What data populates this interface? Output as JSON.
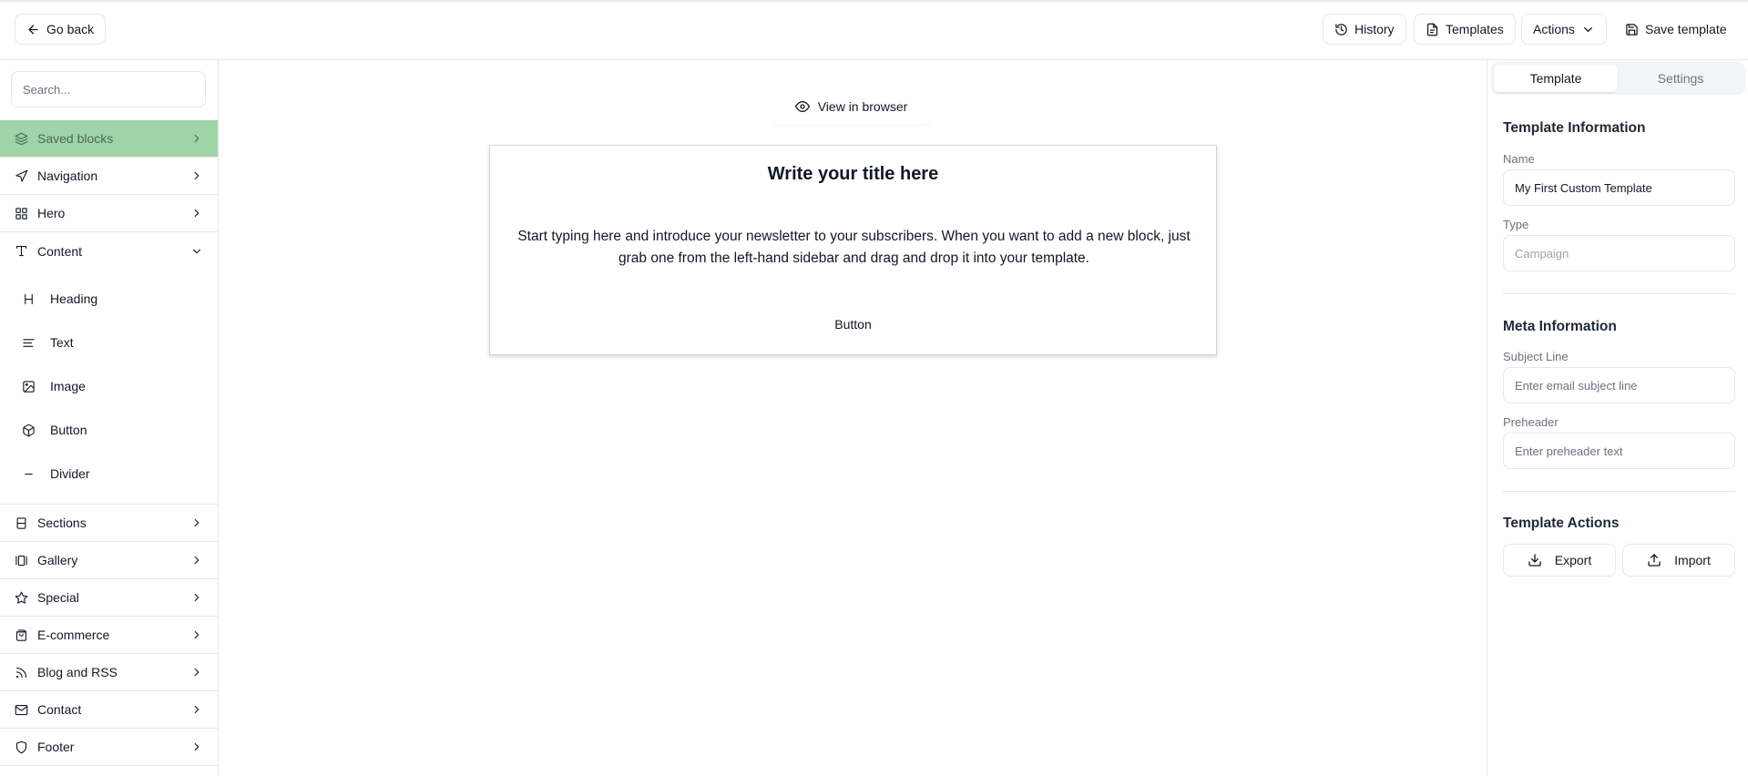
{
  "header": {
    "go_back": "Go back",
    "history": "History",
    "templates": "Templates",
    "actions": "Actions",
    "save_template": "Save template"
  },
  "sidebar": {
    "search_placeholder": "Search...",
    "saved_blocks": "Saved blocks",
    "categories": [
      {
        "label": "Navigation",
        "icon": "navigation-icon"
      },
      {
        "label": "Hero",
        "icon": "grid-icon"
      },
      {
        "label": "Content",
        "icon": "type-icon",
        "expanded": true
      }
    ],
    "content_items": [
      {
        "label": "Heading",
        "icon": "heading-icon"
      },
      {
        "label": "Text",
        "icon": "text-lines-icon"
      },
      {
        "label": "Image",
        "icon": "image-icon"
      },
      {
        "label": "Button",
        "icon": "box-icon"
      },
      {
        "label": "Divider",
        "icon": "minus-icon"
      }
    ],
    "more_categories": [
      {
        "label": "Sections",
        "icon": "sections-icon"
      },
      {
        "label": "Gallery",
        "icon": "gallery-icon"
      },
      {
        "label": "Special",
        "icon": "star-icon"
      },
      {
        "label": "E-commerce",
        "icon": "shopping-bag-icon"
      },
      {
        "label": "Blog and RSS",
        "icon": "rss-icon"
      },
      {
        "label": "Contact",
        "icon": "mail-icon"
      },
      {
        "label": "Footer",
        "icon": "shield-icon"
      }
    ]
  },
  "canvas": {
    "view_in_browser": "View in browser",
    "email": {
      "title": "Write your title here",
      "body": "Start typing here and introduce your newsletter to your subscribers. When you want to add a new block, just grab one from the left-hand sidebar and drag and drop it into your template.",
      "button": "Button"
    }
  },
  "panel": {
    "tabs": [
      "Template",
      "Settings"
    ],
    "active_tab": "Template",
    "template_info_title": "Template Information",
    "name_label": "Name",
    "name_value": "My First Custom Template",
    "type_label": "Type",
    "type_value": "Campaign",
    "meta_title": "Meta Information",
    "subject_label": "Subject Line",
    "subject_placeholder": "Enter email subject line",
    "preheader_label": "Preheader",
    "preheader_placeholder": "Enter preheader text",
    "actions_title": "Template Actions",
    "export": "Export",
    "import": "Import"
  },
  "colors": {
    "saved_blocks_bg": "#9fd4a8",
    "border": "#e5e7eb",
    "muted_text": "#6b7280"
  }
}
